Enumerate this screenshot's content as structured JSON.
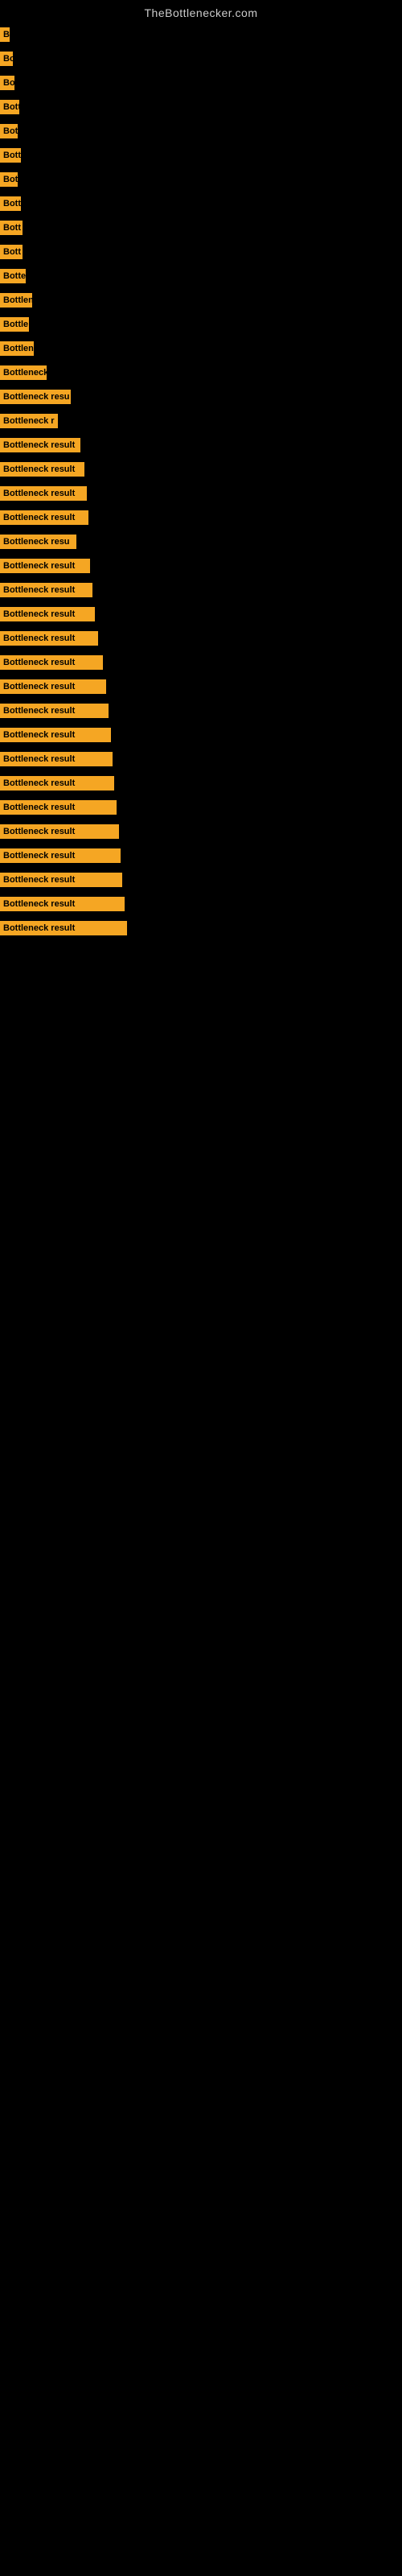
{
  "site_title": "TheBottlenecker.com",
  "bars": [
    {
      "label": "B",
      "width": 12
    },
    {
      "label": "Bo",
      "width": 16
    },
    {
      "label": "Bo",
      "width": 18
    },
    {
      "label": "Bott",
      "width": 24
    },
    {
      "label": "Bot",
      "width": 22
    },
    {
      "label": "Bott",
      "width": 26
    },
    {
      "label": "Bot",
      "width": 22
    },
    {
      "label": "Bott",
      "width": 26
    },
    {
      "label": "Bott",
      "width": 28
    },
    {
      "label": "Bott",
      "width": 28
    },
    {
      "label": "Botte",
      "width": 32
    },
    {
      "label": "Bottlen",
      "width": 40
    },
    {
      "label": "Bottle",
      "width": 36
    },
    {
      "label": "Bottlen",
      "width": 42
    },
    {
      "label": "Bottleneck",
      "width": 58
    },
    {
      "label": "Bottleneck resu",
      "width": 88
    },
    {
      "label": "Bottleneck r",
      "width": 72
    },
    {
      "label": "Bottleneck result",
      "width": 100
    },
    {
      "label": "Bottleneck result",
      "width": 105
    },
    {
      "label": "Bottleneck result",
      "width": 108
    },
    {
      "label": "Bottleneck result",
      "width": 110
    },
    {
      "label": "Bottleneck resu",
      "width": 95
    },
    {
      "label": "Bottleneck result",
      "width": 112
    },
    {
      "label": "Bottleneck result",
      "width": 115
    },
    {
      "label": "Bottleneck result",
      "width": 118
    },
    {
      "label": "Bottleneck result",
      "width": 122
    },
    {
      "label": "Bottleneck result",
      "width": 128
    },
    {
      "label": "Bottleneck result",
      "width": 132
    },
    {
      "label": "Bottleneck result",
      "width": 135
    },
    {
      "label": "Bottleneck result",
      "width": 138
    },
    {
      "label": "Bottleneck result",
      "width": 140
    },
    {
      "label": "Bottleneck result",
      "width": 142
    },
    {
      "label": "Bottleneck result",
      "width": 145
    },
    {
      "label": "Bottleneck result",
      "width": 148
    },
    {
      "label": "Bottleneck result",
      "width": 150
    },
    {
      "label": "Bottleneck result",
      "width": 152
    },
    {
      "label": "Bottleneck result",
      "width": 155
    },
    {
      "label": "Bottleneck result",
      "width": 158
    }
  ]
}
